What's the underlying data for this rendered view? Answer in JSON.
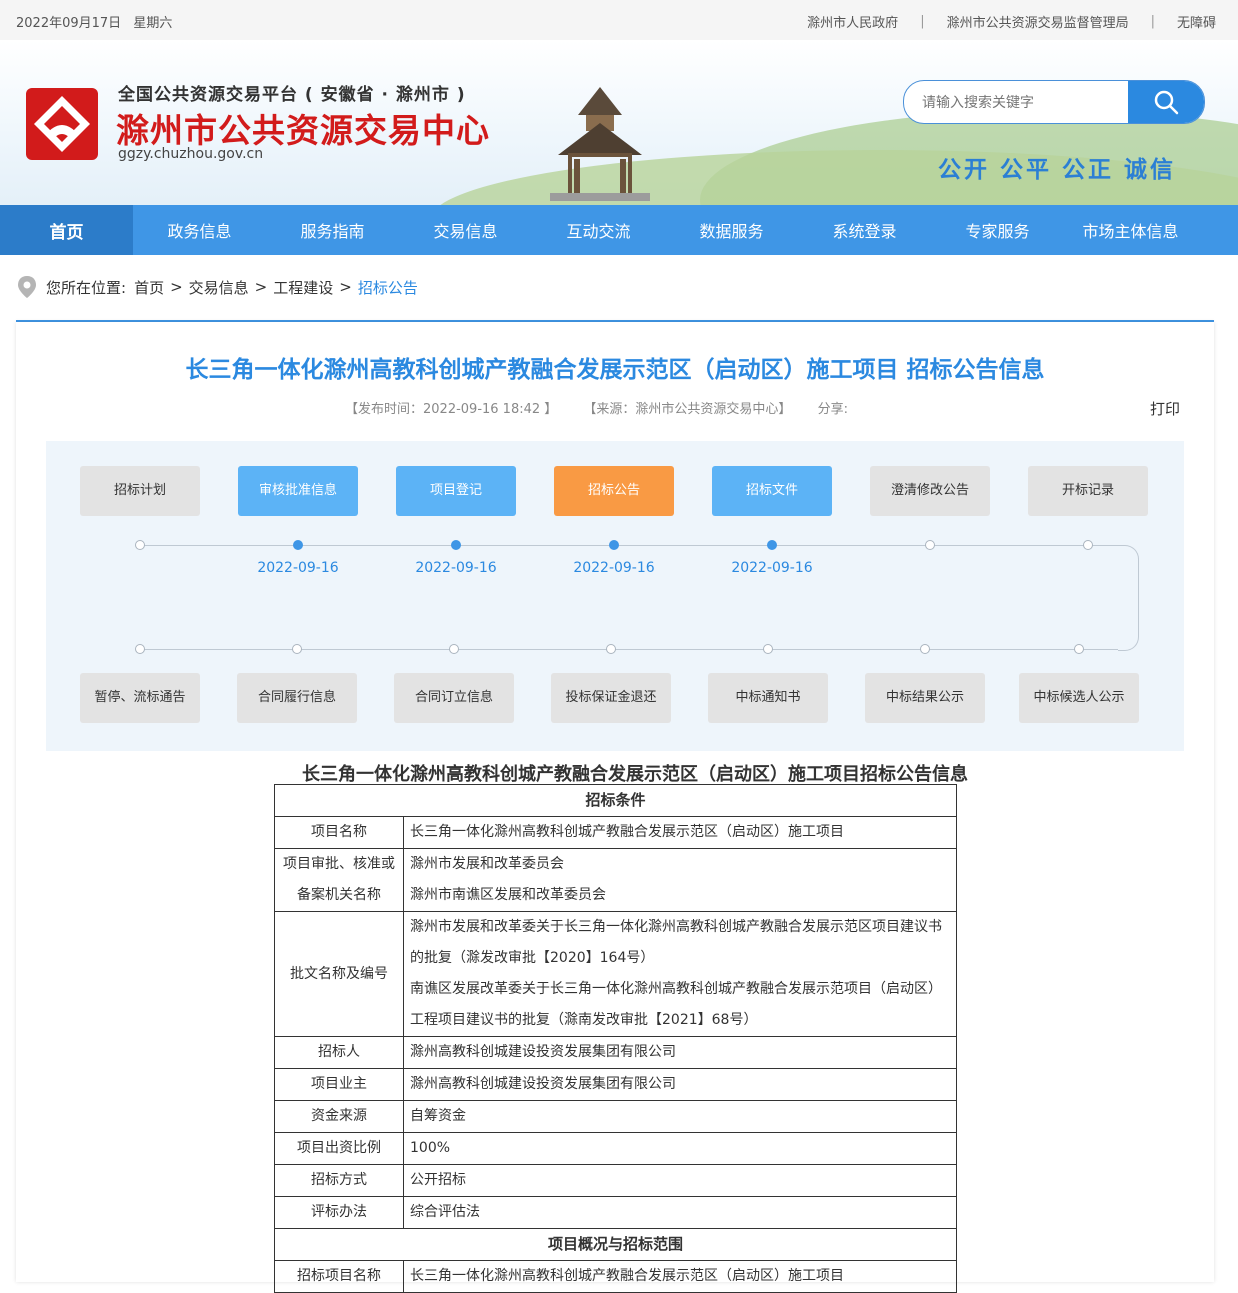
{
  "topbar": {
    "date": "2022年09月17日",
    "weekday": "星期六",
    "links": [
      "滁州市人民政府",
      "滁州市公共资源交易监督管理局",
      "无障碍"
    ],
    "separator": "|"
  },
  "header": {
    "platform": "全国公共资源交易平台 ( 安徽省 · 滁州市 )",
    "center_name": "滁州市公共资源交易中心",
    "domain": "ggzy.chuzhou.gov.cn",
    "search_placeholder": "请输入搜索关键字",
    "slogans": [
      "公开",
      "公平",
      "公正",
      "诚信"
    ]
  },
  "nav": [
    "首页",
    "政务信息",
    "服务指南",
    "交易信息",
    "互动交流",
    "数据服务",
    "系统登录",
    "专家服务",
    "市场主体信息"
  ],
  "breadcrumb": {
    "label": "您所在位置:",
    "items": [
      "首页",
      "交易信息",
      "工程建设",
      "招标公告"
    ],
    "gt": ">"
  },
  "article": {
    "title": "长三角一体化滁州高教科创城产教融合发展示范区（启动区）施工项目 招标公告信息",
    "publish_time": "【发布时间：2022-09-16 18:42 】",
    "source": "【来源：滁州市公共资源交易中心】",
    "share": "分享:",
    "print": "打印"
  },
  "flow": {
    "top_steps": [
      {
        "label": "招标计划",
        "state": "off",
        "date": ""
      },
      {
        "label": "审核批准信息",
        "state": "on",
        "date": "2022-09-16"
      },
      {
        "label": "项目登记",
        "state": "on",
        "date": "2022-09-16"
      },
      {
        "label": "招标公告",
        "state": "cur",
        "date": "2022-09-16"
      },
      {
        "label": "招标文件",
        "state": "on",
        "date": "2022-09-16"
      },
      {
        "label": "澄清修改公告",
        "state": "off",
        "date": ""
      },
      {
        "label": "开标记录",
        "state": "off",
        "date": ""
      }
    ],
    "bottom_steps": [
      "暂停、流标通告",
      "合同履行信息",
      "合同订立信息",
      "投标保证金退还",
      "中标通知书",
      "中标结果公示",
      "中标候选人公示"
    ]
  },
  "doc": {
    "title": "长三角一体化滁州高教科创城产教融合发展示范区（启动区）施工项目招标公告信息",
    "section1": "招标条件",
    "rows": [
      {
        "k": "项目名称",
        "v": [
          "长三角一体化滁州高教科创城产教融合发展示范区（启动区）施工项目"
        ]
      },
      {
        "k": "项目审批、核准或备案机关名称",
        "v": [
          "滁州市发展和改革委员会",
          "滁州市南谯区发展和改革委员会"
        ]
      },
      {
        "k": "批文名称及编号",
        "v": [
          "滁州市发展和改革委关于长三角一体化滁州高教科创城产教融合发展示范区项目建议书的批复（滁发改审批【2020】164号）",
          "南谯区发展改革委关于长三角一体化滁州高教科创城产教融合发展示范项目（启动区）工程项目建议书的批复（滁南发改审批【2021】68号）"
        ]
      },
      {
        "k": "招标人",
        "v": [
          "滁州高教科创城建设投资发展集团有限公司"
        ]
      },
      {
        "k": "项目业主",
        "v": [
          "滁州高教科创城建设投资发展集团有限公司"
        ]
      },
      {
        "k": "资金来源",
        "v": [
          "自筹资金"
        ]
      },
      {
        "k": "项目出资比例",
        "v": [
          "100%"
        ]
      },
      {
        "k": "招标方式",
        "v": [
          "公开招标"
        ]
      },
      {
        "k": "评标办法",
        "v": [
          "综合评估法"
        ]
      }
    ],
    "section2": "项目概况与招标范围",
    "rows2": [
      {
        "k": "招标项目名称",
        "v": [
          "长三角一体化滁州高教科创城产教融合发展示范区（启动区）施工项目"
        ]
      }
    ]
  },
  "colors": {
    "accent": "#3f96e6",
    "nav_active": "#2c7cc9",
    "current_step": "#f99a44",
    "done_step": "#5cb3f6",
    "brand_red": "#d21b1b"
  }
}
